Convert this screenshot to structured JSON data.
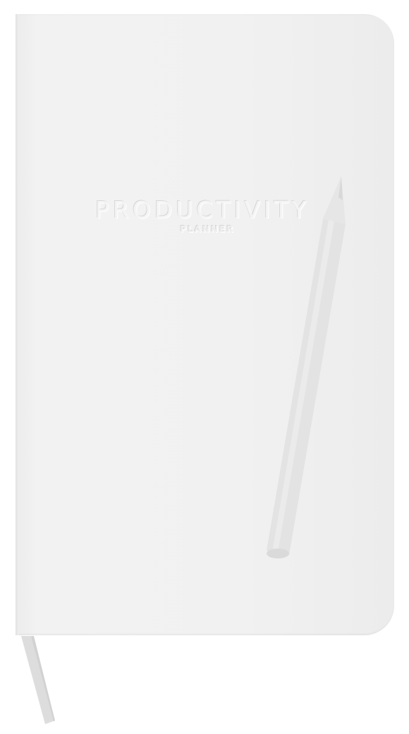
{
  "cover": {
    "title": "PRODUCTIVITY",
    "subtitle": "PLANNER"
  },
  "colors": {
    "background": "#ffffff",
    "cover": "#f0f0f0",
    "pencil": "#e2e2e2",
    "ribbon": "#dcdcdc"
  }
}
